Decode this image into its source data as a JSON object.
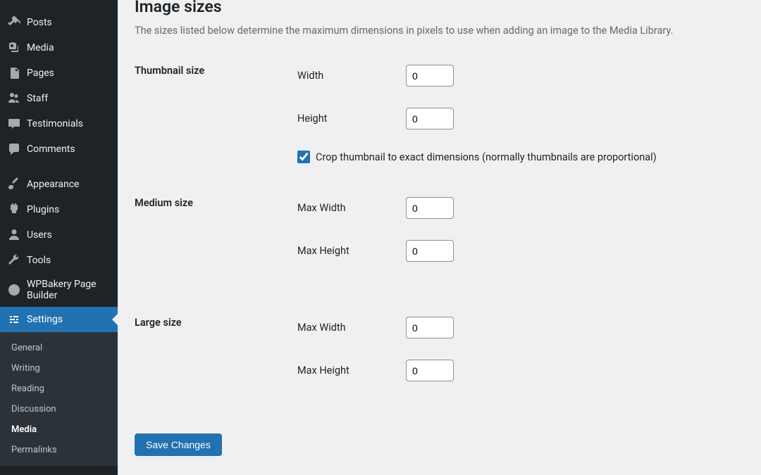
{
  "sidebar": {
    "items": [
      {
        "label": "Posts",
        "icon": "pin"
      },
      {
        "label": "Media",
        "icon": "media"
      },
      {
        "label": "Pages",
        "icon": "pages"
      },
      {
        "label": "Staff",
        "icon": "users"
      },
      {
        "label": "Testimonials",
        "icon": "testimonial"
      },
      {
        "label": "Comments",
        "icon": "comment"
      }
    ],
    "items2": [
      {
        "label": "Appearance",
        "icon": "brush"
      },
      {
        "label": "Plugins",
        "icon": "plug"
      },
      {
        "label": "Users",
        "icon": "user"
      },
      {
        "label": "Tools",
        "icon": "wrench"
      },
      {
        "label": "WPBakery Page Builder",
        "icon": "wpbakery"
      },
      {
        "label": "Settings",
        "icon": "settings",
        "active": true
      }
    ],
    "submenu": [
      {
        "label": "General"
      },
      {
        "label": "Writing"
      },
      {
        "label": "Reading"
      },
      {
        "label": "Discussion"
      },
      {
        "label": "Media",
        "current": true
      },
      {
        "label": "Permalinks"
      }
    ]
  },
  "main": {
    "title": "Image sizes",
    "description": "The sizes listed below determine the maximum dimensions in pixels to use when adding an image to the Media Library.",
    "thumbnail_label": "Thumbnail size",
    "medium_label": "Medium size",
    "large_label": "Large size",
    "width_label": "Width",
    "height_label": "Height",
    "max_width_label": "Max Width",
    "max_height_label": "Max Height",
    "crop_label": "Crop thumbnail to exact dimensions (normally thumbnails are proportional)",
    "thumbnail_width": "0",
    "thumbnail_height": "0",
    "crop_checked": true,
    "medium_width": "0",
    "medium_height": "0",
    "large_width": "0",
    "large_height": "0",
    "save_label": "Save Changes"
  }
}
